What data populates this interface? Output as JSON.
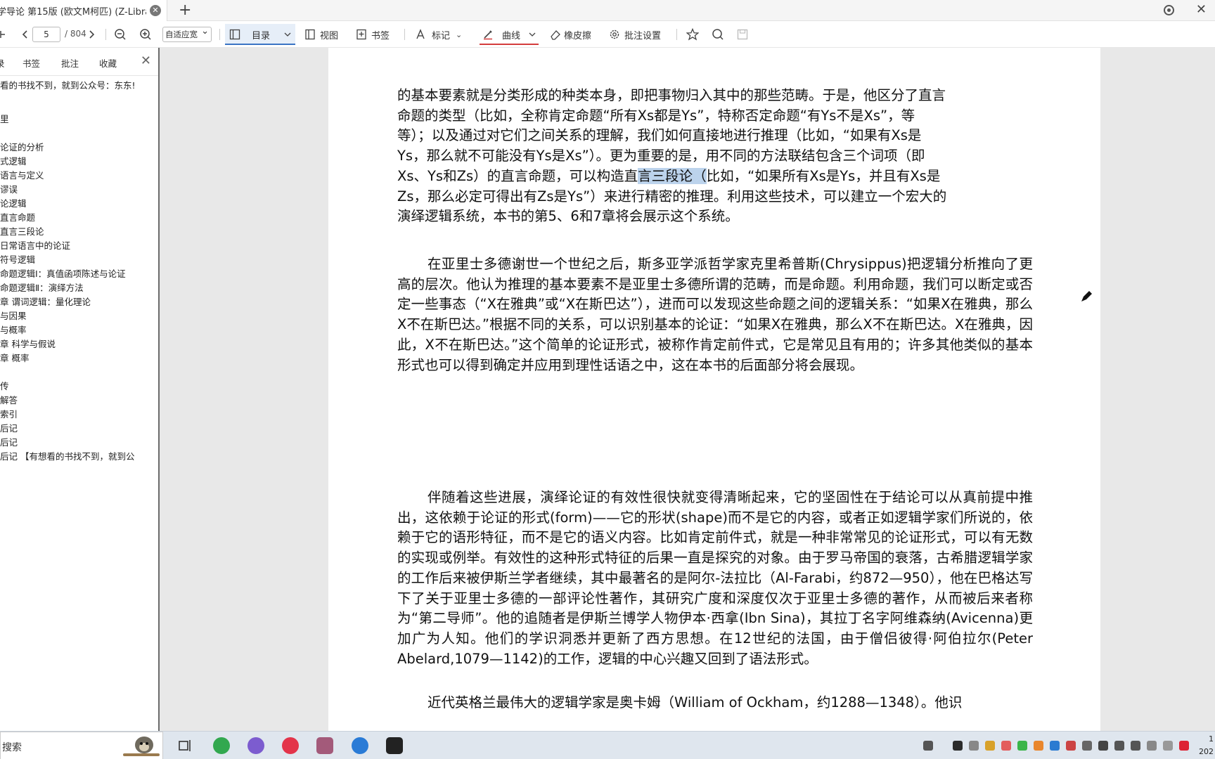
{
  "tab": {
    "title": "学导论 第15版 (欧文M柯匹) (Z-Librar...",
    "close_glyph": "✕",
    "add_glyph": "+"
  },
  "window": {
    "close_glyph": "✕"
  },
  "toolbar": {
    "page_current": "5",
    "page_total": "/ 804",
    "fit_mode": "自适应宽",
    "toc_label": "目录",
    "view_label": "视图",
    "bookmark_label": "书签",
    "mark_label": "标记",
    "curve_label": "曲线",
    "eraser_label": "橡皮擦",
    "annot_settings_label": "批注设置"
  },
  "sidebar": {
    "tabs": [
      "录",
      "书签",
      "批注",
      "收藏"
    ],
    "close_glyph": "✕",
    "note": "看的书找不到，就到公众号：东东!",
    "toc": [
      "里",
      "",
      "论证的分析",
      "式逻辑",
      "语言与定义",
      "谬误",
      "论逻辑",
      "直言命题",
      "直言三段论",
      "日常语言中的论证",
      "符号逻辑",
      "命题逻辑Ⅰ：真值函项陈述与论证",
      "命题逻辑Ⅱ：演绎方法",
      "章 谓词逻辑：量化理论",
      "与因果",
      "与概率",
      "章 科学与假说",
      "章 概率",
      "",
      "传",
      "解答",
      "索引",
      "后记",
      "后记",
      "后记 【有想看的书找不到，就到公"
    ]
  },
  "document": {
    "page1": {
      "p1_lines": [
        "的基本要素就是分类形成的种类本身，即把事物归入其中的那些范畴。于是，他区分了直言",
        "命题的类型（比如，全称肯定命题“所有Xs都是Ys”，特称否定命题“有Ys不是Xs”，等",
        "等）；以及通过对它们之间关系的理解，我们如何直接地进行推理（比如，“如果有Xs是",
        "Ys，那么就不可能没有Ys是Xs”）。更为重要的是，用不同的方法联结包含三个词项（即"
      ],
      "p1_l5_pre": "Xs、Ys和Zs）的直言命题，可以构造直",
      "p1_l5_hl": "言三段论（",
      "p1_l5_post": "比如，“如果所有Xs是Ys，并且有Xs是",
      "p1_tail_lines": [
        "Zs，那么必定可得出有Zs是Ys”）来进行精密的推理。利用这些技术，可以建立一个宏大的",
        "演绎逻辑系统，本书的第5、6和7章将会展示这个系统。"
      ],
      "p2": "在亚里士多德谢世一个世纪之后，斯多亚学派哲学家克里希普斯(Chrysippus)把逻辑分析推向了更高的层次。他认为推理的基本要素不是亚里士多德所谓的范畴，而是命题。利用命题，我们可以断定或否定一些事态（“X在雅典”或“X在斯巴达”），进而可以发现这些命题之间的逻辑关系：“如果X在雅典，那么X不在斯巴达。”根据不同的关系，可以识别基本的论证：“如果X在雅典，那么X不在斯巴达。X在雅典，因此，X不在斯巴达。”这个简单的论证形式，被称作肯定前件式，它是常见且有用的；许多其他类似的基本形式也可以得到确定并应用到理性话语之中，这在本书的后面部分将会展现。"
    },
    "page2": {
      "p1": "伴随着这些进展，演绎论证的有效性很快就变得清晰起来，它的坚固性在于结论可以从真前提中推出，这依赖于论证的形式(form)——它的形状(shape)而不是它的内容，或者正如逻辑学家们所说的，依赖于它的语形特征，而不是它的语义内容。比如肯定前件式，就是一种非常常见的论证形式，可以有无数的实现或例举。有效性的这种形式特征的后果一直是探究的对象。由于罗马帝国的衰落，古希腊逻辑学家的工作后来被伊斯兰学者继续，其中最著名的是阿尔-法拉比（Al-Farabi，约872—950），他在巴格达写下了关于亚里士多德的一部评论性著作，其研究广度和深度仅次于亚里士多德的著作，从而被后来者称为“第二导师”。他的追随者是伊斯兰博学人物伊本·西拿(Ibn Sina)，其拉丁名字阿维森纳(Avicenna)更加广为人知。他们的学识洞悉并更新了西方思想。在12世纪的法国，由于僧侣彼得·阿伯拉尔(Peter Abelard,1079—1142)的工作，逻辑的中心兴趣又回到了语法形式。",
      "p2": "近代英格兰最伟大的逻辑学家是奥卡姆（William of Ockham，约1288—1348）。他识"
    }
  },
  "taskbar": {
    "search_text": "搜索",
    "clock_time": "1",
    "clock_date": "202"
  },
  "colors": {
    "highlight": "#bcd3ec",
    "accent_blue": "#3a74c4",
    "accent_red": "#d43c3c"
  }
}
